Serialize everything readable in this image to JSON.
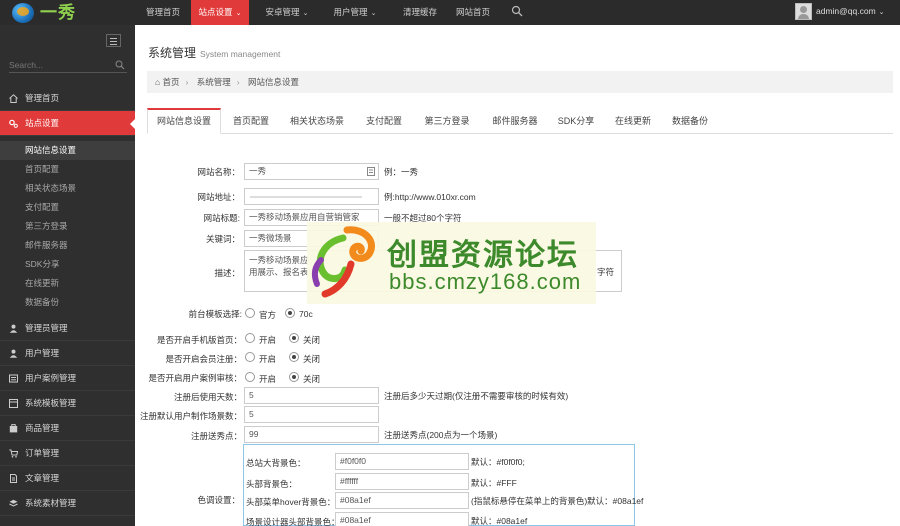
{
  "app": {
    "logo_text": "一秀"
  },
  "topnav": [
    {
      "label": "管理首页",
      "caret": false
    },
    {
      "label": "站点设置",
      "caret": true,
      "active": true
    },
    {
      "label": "安卓管理",
      "caret": true
    },
    {
      "label": "用户管理",
      "caret": true
    },
    {
      "label": "清理缓存",
      "caret": false
    },
    {
      "label": "网站首页",
      "caret": false
    }
  ],
  "user": {
    "name": "admin@qq.com"
  },
  "sidebar": {
    "search_placeholder": "Search...",
    "items": [
      {
        "label": "管理首页"
      },
      {
        "label": "站点设置",
        "active": true
      },
      {
        "label": "管理员管理"
      },
      {
        "label": "用户管理"
      },
      {
        "label": "用户案例管理"
      },
      {
        "label": "系统模板管理"
      },
      {
        "label": "商品管理"
      },
      {
        "label": "订单管理"
      },
      {
        "label": "文章管理"
      },
      {
        "label": "系统素材管理"
      }
    ],
    "subitems": [
      {
        "label": "网站信息设置",
        "active": true
      },
      {
        "label": "首页配置"
      },
      {
        "label": "相关状态场景"
      },
      {
        "label": "支付配置"
      },
      {
        "label": "第三方登录"
      },
      {
        "label": "邮件服务器"
      },
      {
        "label": "SDK分享"
      },
      {
        "label": "在线更新"
      },
      {
        "label": "数据备份"
      }
    ]
  },
  "page": {
    "title": "系统管理",
    "subtitle": "System management"
  },
  "breadcrumb": [
    "首页",
    "系统管理",
    "网站信息设置"
  ],
  "tabs": [
    "网站信息设置",
    "首页配置",
    "相关状态场景",
    "支付配置",
    "第三方登录",
    "邮件服务器",
    "SDK分享",
    "在线更新",
    "数据备份"
  ],
  "form": {
    "site_name": {
      "label": "网站名称：",
      "value": "一秀",
      "hint": "例：一秀"
    },
    "site_url": {
      "label": "网站地址：",
      "value": "",
      "hint": "例:http://www.010xr.com"
    },
    "site_title": {
      "label": "网站标题:",
      "value": "一秀移动场景应用自营销管家",
      "hint": "一般不超过80个字符"
    },
    "keywords": {
      "label": "关键词：",
      "value": "一秀微场景"
    },
    "description": {
      "label": "描述：",
      "value": "一秀移动场景应\n用展示、报名表",
      "hint": "字符"
    },
    "template": {
      "label": "前台模板选择:",
      "options": [
        "官方",
        "70c"
      ],
      "selected": 1
    },
    "mobile_home": {
      "label": "是否开启手机版首页：",
      "options": [
        "开启",
        "关闭"
      ],
      "selected": 1
    },
    "member_reg": {
      "label": "是否开启会员注册：",
      "options": [
        "开启",
        "关闭"
      ],
      "selected": 1
    },
    "case_review": {
      "label": "是否开启用户案例审核：",
      "options": [
        "开启",
        "关闭"
      ],
      "selected": 1
    },
    "reg_days": {
      "label": "注册后使用天数：",
      "value": "5",
      "hint": "注册后多少天过期(仅注册不需要审核的时候有效)"
    },
    "default_count": {
      "label": "注册默认用户制作场景数：",
      "value": "5"
    },
    "reg_points": {
      "label": "注册送秀点：",
      "value": "99",
      "hint": "注册送秀点(200点为一个场景)"
    },
    "colors": {
      "label": "色调设置：",
      "rows": [
        {
          "label": "总站大背景色：",
          "value": "#f0f0f0",
          "hint": "默认：#f0f0f0;"
        },
        {
          "label": "头部背景色：",
          "value": "#ffffff",
          "hint": "默认：#FFF"
        },
        {
          "label": "头部菜单hover背景色：",
          "value": "#08a1ef",
          "hint": "(指鼠标悬停在菜单上的背景色)默认：#08a1ef"
        },
        {
          "label": "场景设计器头部背景色：",
          "value": "#08a1ef",
          "hint": "默认：#08a1ef"
        }
      ]
    }
  },
  "watermark": {
    "title": "创盟资源论坛",
    "url": "bbs.cmzy168.com"
  }
}
